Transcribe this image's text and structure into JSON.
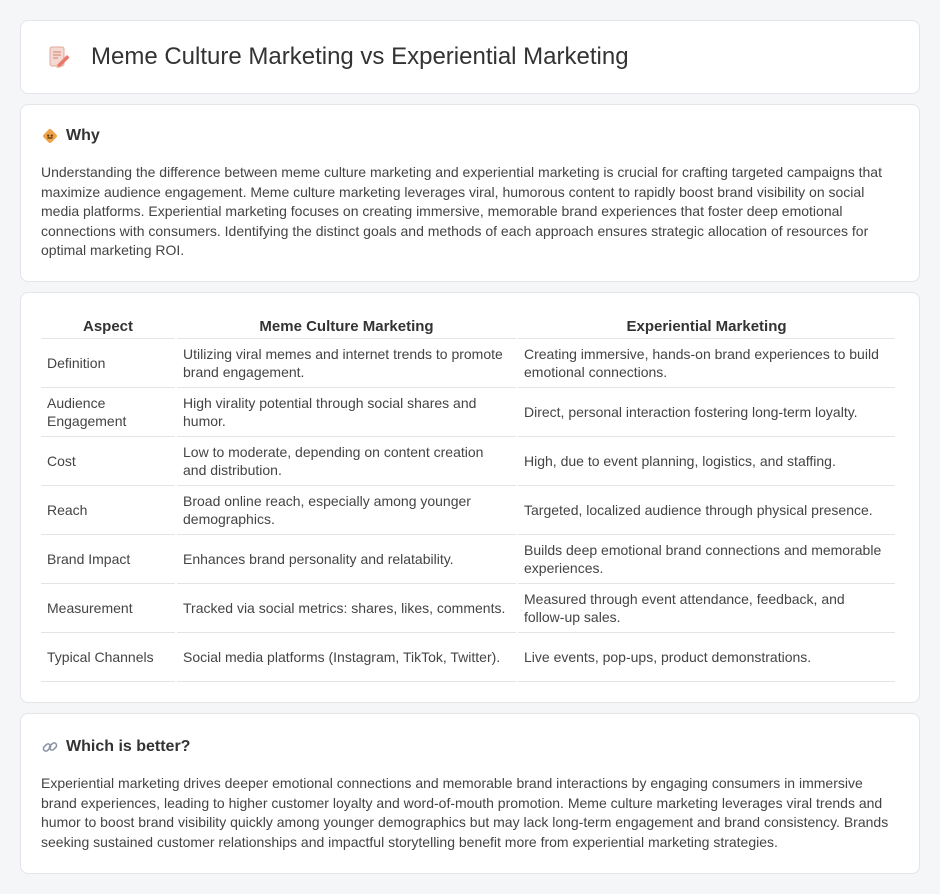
{
  "header": {
    "title": "Meme Culture Marketing vs Experiential Marketing"
  },
  "why": {
    "title": "Why",
    "text": "Understanding the difference between meme culture marketing and experiential marketing is crucial for crafting targeted campaigns that maximize audience engagement. Meme culture marketing leverages viral, humorous content to rapidly boost brand visibility on social media platforms. Experiential marketing focuses on creating immersive, memorable brand experiences that foster deep emotional connections with consumers. Identifying the distinct goals and methods of each approach ensures strategic allocation of resources for optimal marketing ROI."
  },
  "table": {
    "headers": [
      "Aspect",
      "Meme Culture Marketing",
      "Experiential Marketing"
    ],
    "rows": [
      [
        "Definition",
        "Utilizing viral memes and internet trends to promote brand engagement.",
        "Creating immersive, hands-on brand experiences to build emotional connections."
      ],
      [
        "Audience Engagement",
        "High virality potential through social shares and humor.",
        "Direct, personal interaction fostering long-term loyalty."
      ],
      [
        "Cost",
        "Low to moderate, depending on content creation and distribution.",
        "High, due to event planning, logistics, and staffing."
      ],
      [
        "Reach",
        "Broad online reach, especially among younger demographics.",
        "Targeted, localized audience through physical presence."
      ],
      [
        "Brand Impact",
        "Enhances brand personality and relatability.",
        "Builds deep emotional brand connections and memorable experiences."
      ],
      [
        "Measurement",
        "Tracked via social metrics: shares, likes, comments.",
        "Measured through event attendance, feedback, and follow-up sales."
      ],
      [
        "Typical Channels",
        "Social media platforms (Instagram, TikTok, Twitter).",
        "Live events, pop-ups, product demonstrations."
      ]
    ]
  },
  "better": {
    "title": "Which is better?",
    "text": "Experiential marketing drives deeper emotional connections and memorable brand interactions by engaging consumers in immersive brand experiences, leading to higher customer loyalty and word-of-mouth promotion. Meme culture marketing leverages viral trends and humor to boost brand visibility quickly among younger demographics but may lack long-term engagement and brand consistency. Brands seeking sustained customer relationships and impactful storytelling benefit more from experiential marketing strategies."
  },
  "icons": {
    "title": "memo-pencil-icon",
    "why": "diamond-warning-icon",
    "better": "link-icon"
  },
  "colors": {
    "accent_orange": "#f0a24a",
    "pencil_red": "#e9776a"
  }
}
